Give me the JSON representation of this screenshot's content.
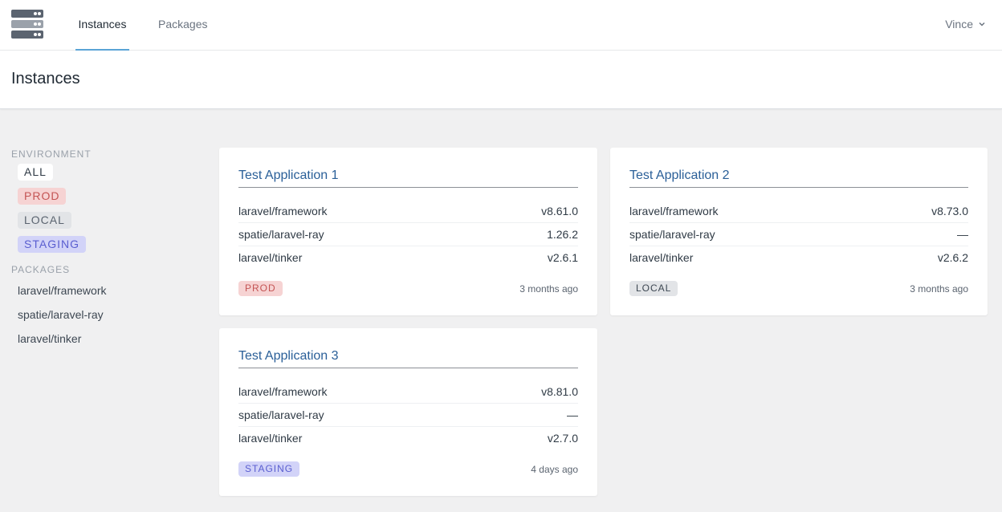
{
  "nav": {
    "logo_icon": "server-rack-icon",
    "tabs": [
      {
        "label": "Instances",
        "active": true
      },
      {
        "label": "Packages",
        "active": false
      }
    ],
    "user": {
      "name": "Vince",
      "icon": "chevron-down-icon"
    }
  },
  "header": {
    "title": "Instances"
  },
  "sidebar": {
    "environment_heading": "ENVIRONMENT",
    "environments": [
      "ALL",
      "PROD",
      "LOCAL",
      "STAGING"
    ],
    "packages_heading": "PACKAGES",
    "packages": [
      "laravel/framework",
      "spatie/laravel-ray",
      "laravel/tinker"
    ]
  },
  "cards": [
    {
      "title": "Test Application 1",
      "rows": [
        {
          "name": "laravel/framework",
          "version": "v8.61.0"
        },
        {
          "name": "spatie/laravel-ray",
          "version": "1.26.2"
        },
        {
          "name": "laravel/tinker",
          "version": "v2.6.1"
        }
      ],
      "env": "PROD",
      "updated": "3 months ago"
    },
    {
      "title": "Test Application 2",
      "rows": [
        {
          "name": "laravel/framework",
          "version": "v8.73.0"
        },
        {
          "name": "spatie/laravel-ray",
          "version": "—"
        },
        {
          "name": "laravel/tinker",
          "version": "v2.6.2"
        }
      ],
      "env": "LOCAL",
      "updated": "3 months ago"
    },
    {
      "title": "Test Application 3",
      "rows": [
        {
          "name": "laravel/framework",
          "version": "v8.81.0"
        },
        {
          "name": "spatie/laravel-ray",
          "version": "—"
        },
        {
          "name": "laravel/tinker",
          "version": "v2.7.0"
        }
      ],
      "env": "STAGING",
      "updated": "4 days ago"
    }
  ],
  "colors": {
    "accent": "#5aa4d6",
    "link": "#2a5f98",
    "prod_bg": "#f6d3d3",
    "local_bg": "#e2e4e7",
    "staging_bg": "#d2d3f8"
  }
}
